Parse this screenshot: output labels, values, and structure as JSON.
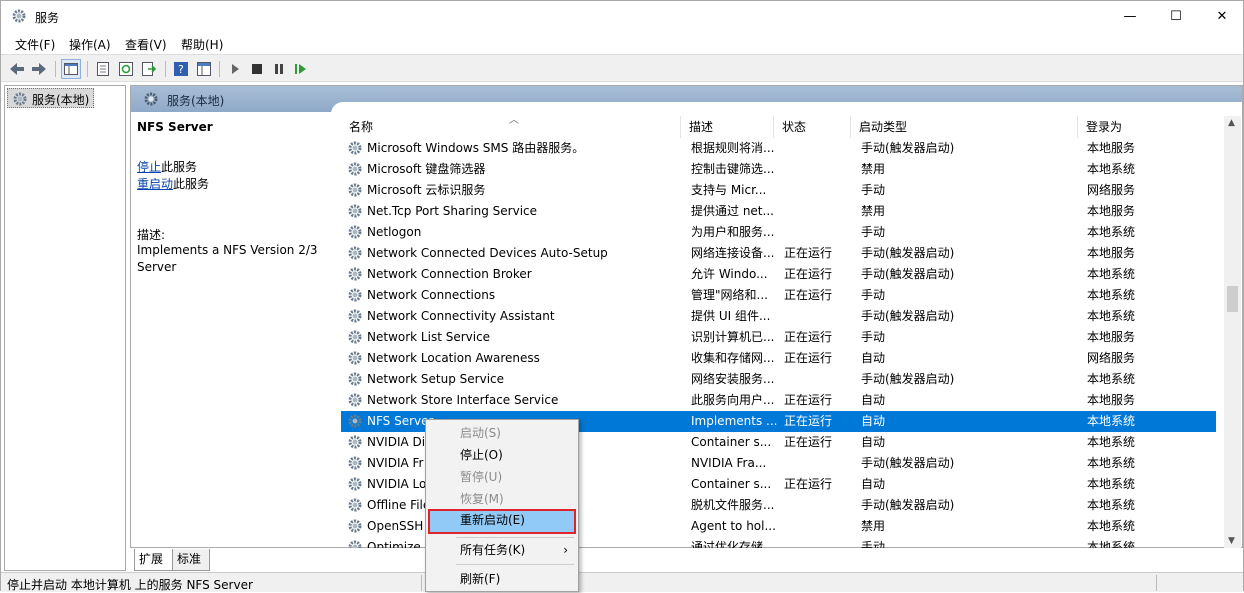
{
  "window": {
    "title": "服务",
    "icon": "gear-services-icon"
  },
  "title_buttons": {
    "minimize": "—",
    "maximize": "☐",
    "close": "✕"
  },
  "menu": [
    "文件(F)",
    "操作(A)",
    "查看(V)",
    "帮助(H)"
  ],
  "tree": {
    "item": "服务(本地)"
  },
  "main": {
    "header": "服务(本地)"
  },
  "details": {
    "service_name": "NFS Server",
    "stop_link": "停止",
    "stop_suffix": "此服务",
    "restart_link": "重启动",
    "restart_suffix": "此服务",
    "desc_label": "描述:",
    "desc_line1": "Implements a NFS Version 2/3",
    "desc_line2": "Server"
  },
  "columns": [
    "名称",
    "描述",
    "状态",
    "启动类型",
    "登录为"
  ],
  "rows": [
    {
      "name": "Microsoft Windows SMS 路由器服务。",
      "desc": "根据规则将消...",
      "status": "",
      "startup": "手动(触发器启动)",
      "logon": "本地服务"
    },
    {
      "name": "Microsoft 键盘筛选器",
      "desc": "控制击键筛选...",
      "status": "",
      "startup": "禁用",
      "logon": "本地系统"
    },
    {
      "name": "Microsoft 云标识服务",
      "desc": "支持与 Micr...",
      "status": "",
      "startup": "手动",
      "logon": "网络服务"
    },
    {
      "name": "Net.Tcp Port Sharing Service",
      "desc": "提供通过 net...",
      "status": "",
      "startup": "禁用",
      "logon": "本地服务"
    },
    {
      "name": "Netlogon",
      "desc": "为用户和服务...",
      "status": "",
      "startup": "手动",
      "logon": "本地系统"
    },
    {
      "name": "Network Connected Devices Auto-Setup",
      "desc": "网络连接设备...",
      "status": "正在运行",
      "startup": "手动(触发器启动)",
      "logon": "本地服务"
    },
    {
      "name": "Network Connection Broker",
      "desc": "允许 Windo...",
      "status": "正在运行",
      "startup": "手动(触发器启动)",
      "logon": "本地系统"
    },
    {
      "name": "Network Connections",
      "desc": "管理\"网络和...",
      "status": "正在运行",
      "startup": "手动",
      "logon": "本地系统"
    },
    {
      "name": "Network Connectivity Assistant",
      "desc": "提供 UI 组件...",
      "status": "",
      "startup": "手动(触发器启动)",
      "logon": "本地系统"
    },
    {
      "name": "Network List Service",
      "desc": "识别计算机已...",
      "status": "正在运行",
      "startup": "手动",
      "logon": "本地服务"
    },
    {
      "name": "Network Location Awareness",
      "desc": "收集和存储网...",
      "status": "正在运行",
      "startup": "自动",
      "logon": "网络服务"
    },
    {
      "name": "Network Setup Service",
      "desc": "网络安装服务...",
      "status": "",
      "startup": "手动(触发器启动)",
      "logon": "本地系统"
    },
    {
      "name": "Network Store Interface Service",
      "desc": "此服务向用户...",
      "status": "正在运行",
      "startup": "自动",
      "logon": "本地服务"
    },
    {
      "name": "NFS Server",
      "desc": "Implements ...",
      "status": "正在运行",
      "startup": "自动",
      "logon": "本地系统",
      "selected": true
    },
    {
      "name": "NVIDIA Di",
      "desc": "Container s...",
      "status": "正在运行",
      "startup": "自动",
      "logon": "本地系统"
    },
    {
      "name": "NVIDIA Fr",
      "desc": "NVIDIA Fra...",
      "status": "",
      "startup": "手动(触发器启动)",
      "logon": "本地系统"
    },
    {
      "name": "NVIDIA Lo",
      "desc": "Container s...",
      "status": "正在运行",
      "startup": "自动",
      "logon": "本地系统"
    },
    {
      "name": "Offline File",
      "desc": "脱机文件服务...",
      "status": "",
      "startup": "手动(触发器启动)",
      "logon": "本地系统"
    },
    {
      "name": "OpenSSH",
      "desc": "Agent to hol...",
      "status": "",
      "startup": "禁用",
      "logon": "本地系统"
    },
    {
      "name": "Optimize",
      "desc": "通过优化存储...",
      "status": "",
      "startup": "手动",
      "logon": "本地系统"
    }
  ],
  "tabs": [
    "扩展",
    "标准"
  ],
  "status_bar": "停止并启动 本地计算机 上的服务 NFS Server",
  "context_menu": {
    "items": [
      {
        "label": "启动(S)",
        "disabled": true
      },
      {
        "label": "停止(O)",
        "disabled": false
      },
      {
        "label": "暂停(U)",
        "disabled": true
      },
      {
        "label": "恢复(M)",
        "disabled": true
      },
      {
        "label": "重新启动(E)",
        "disabled": false,
        "highlighted": true
      },
      {
        "label": "所有任务(K)",
        "disabled": false,
        "submenu": true
      },
      {
        "label": "刷新(F)",
        "disabled": false
      }
    ],
    "submenu_arrow": "›"
  },
  "colors": {
    "selection": "#0078d7",
    "highlight": "#91c9f7",
    "highlight_border": "#e0232b"
  }
}
